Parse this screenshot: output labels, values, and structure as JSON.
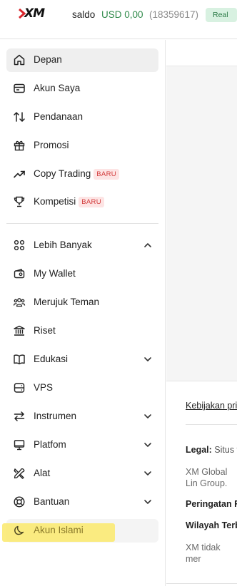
{
  "header": {
    "logo_text": "XM",
    "saldo_label": "saldo",
    "saldo_value": "USD 0,00",
    "account_id": "(18359617)",
    "account_type": "Real"
  },
  "sidebar": {
    "items": [
      {
        "label": "Depan",
        "icon": "home-icon"
      },
      {
        "label": "Akun Saya",
        "icon": "card-icon"
      },
      {
        "label": "Pendanaan",
        "icon": "transfer-arrows-icon"
      },
      {
        "label": "Promosi",
        "icon": "gift-icon"
      },
      {
        "label": "Copy Trading",
        "icon": "trend-up-icon",
        "badge": "BARU"
      },
      {
        "label": "Kompetisi",
        "icon": "trophy-icon",
        "badge": "BARU"
      },
      {
        "label": "Lebih Banyak",
        "icon": "grid-icon"
      },
      {
        "label": "My Wallet",
        "icon": "wallet-icon"
      },
      {
        "label": "Merujuk Teman",
        "icon": "users-icon"
      },
      {
        "label": "Riset",
        "icon": "bank-icon"
      },
      {
        "label": "Edukasi",
        "icon": "book-icon"
      },
      {
        "label": "VPS",
        "icon": "server-icon"
      },
      {
        "label": "Instrumen",
        "icon": "swap-icon"
      },
      {
        "label": "Platfom",
        "icon": "monitor-icon"
      },
      {
        "label": "Alat",
        "icon": "tools-icon"
      },
      {
        "label": "Bantuan",
        "icon": "lifebuoy-icon"
      },
      {
        "label": "Akun Islami",
        "icon": "moon-icon"
      }
    ]
  },
  "footer": {
    "policy_link": "Kebijakan pri",
    "legal_label": "Legal:",
    "legal_text": "Situs v",
    "xm_global_text": "XM Global Lin Group.",
    "peringatan": "Peringatan R",
    "wilayah": "Wilayah Terb",
    "xm_tidak_text": "XM tidak mer pengguna be"
  },
  "colors": {
    "accent_green": "#2f8a4a",
    "badge_red": "#d23a3a",
    "highlight_yellow": "#fbea73"
  }
}
